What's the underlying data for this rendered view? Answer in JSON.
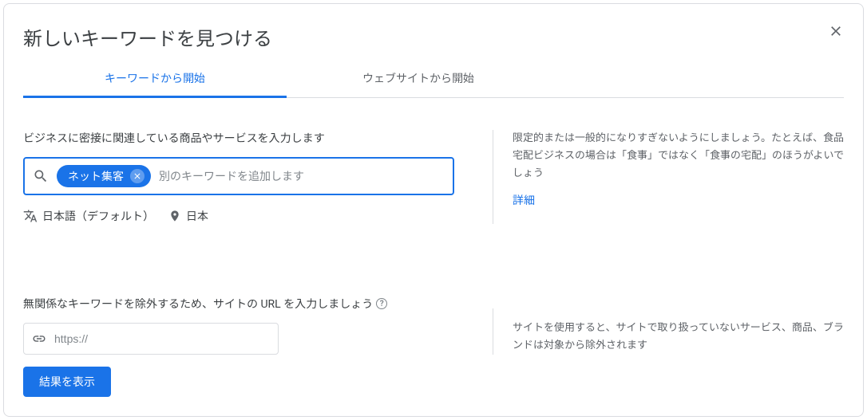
{
  "title": "新しいキーワードを見つける",
  "tabs": {
    "start_keywords": "キーワードから開始",
    "start_website": "ウェブサイトから開始"
  },
  "keywords_section": {
    "label": "ビジネスに密接に関連している商品やサービスを入力します",
    "chip": "ネット集客",
    "placeholder": "別のキーワードを追加します"
  },
  "meta": {
    "language": "日本語（デフォルト）",
    "location": "日本"
  },
  "hint": {
    "text": "限定的または一般的になりすぎないようにしましょう。たとえば、食品宅配ビジネスの場合は「食事」ではなく「食事の宅配」のほうがよいでしょう",
    "link": "詳細"
  },
  "url_section": {
    "label": "無関係なキーワードを除外するため、サイトの URL を入力しましょう",
    "placeholder": "https://",
    "hint": "サイトを使用すると、サイトで取り扱っていないサービス、商品、ブランドは対象から除外されます"
  },
  "submit_label": "結果を表示"
}
